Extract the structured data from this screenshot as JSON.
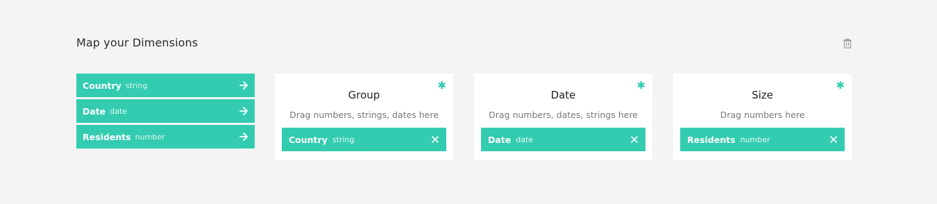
{
  "header": {
    "title": "Map your Dimensions",
    "delete_icon": "trash-icon"
  },
  "dimensions": [
    {
      "name": "Country",
      "type": "string",
      "icon": "arrow-right-icon"
    },
    {
      "name": "Date",
      "type": "date",
      "icon": "arrow-right-icon"
    },
    {
      "name": "Residents",
      "type": "number",
      "icon": "arrow-right-icon"
    }
  ],
  "cards": [
    {
      "title": "Group",
      "hint": "Drag numbers, strings, dates here",
      "required_mark": "✱",
      "chip": {
        "name": "Country",
        "type": "string"
      }
    },
    {
      "title": "Date",
      "hint": "Drag numbers, dates, strings here",
      "required_mark": "✱",
      "chip": {
        "name": "Date",
        "type": "date"
      }
    },
    {
      "title": "Size",
      "hint": "Drag numbers here",
      "required_mark": "✱",
      "chip": {
        "name": "Residents",
        "type": "number"
      }
    }
  ],
  "colors": {
    "accent": "#33ccb0",
    "background": "#f4f4f4"
  }
}
